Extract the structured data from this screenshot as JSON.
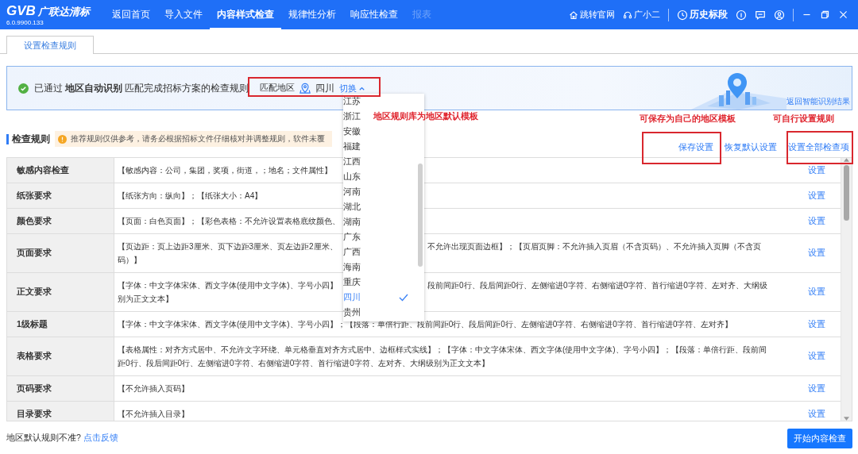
{
  "header": {
    "logo": "GVB",
    "brand": "广联达清标",
    "version": "6.0.9900.133",
    "nav": [
      {
        "label": "返回首页",
        "selected": false,
        "disabled": false
      },
      {
        "label": "导入文件",
        "selected": false,
        "disabled": false
      },
      {
        "label": "内容样式检查",
        "selected": true,
        "disabled": false
      },
      {
        "label": "规律性分析",
        "selected": false,
        "disabled": false
      },
      {
        "label": "响应性检查",
        "selected": false,
        "disabled": false
      },
      {
        "label": "报表",
        "selected": false,
        "disabled": true
      }
    ],
    "links": [
      "跳转官网",
      "广小二"
    ],
    "history": "历史标段"
  },
  "tabs": [
    {
      "label": "设置检查规则",
      "selected": true
    }
  ],
  "banner": {
    "prefix": "已通过",
    "highlight": "地区自动识别",
    "suffix": "匹配完成招标方案的检查规则",
    "region_label": "匹配地区",
    "region": "四川",
    "switch": "切换",
    "back_link": "返回智能识别结果"
  },
  "region_dropdown": [
    {
      "label": "江苏",
      "selected": false
    },
    {
      "label": "浙江",
      "selected": false
    },
    {
      "label": "安徽",
      "selected": false
    },
    {
      "label": "福建",
      "selected": false
    },
    {
      "label": "江西",
      "selected": false
    },
    {
      "label": "山东",
      "selected": false
    },
    {
      "label": "河南",
      "selected": false
    },
    {
      "label": "湖北",
      "selected": false
    },
    {
      "label": "湖南",
      "selected": false
    },
    {
      "label": "广东",
      "selected": false
    },
    {
      "label": "广西",
      "selected": false
    },
    {
      "label": "海南",
      "selected": false
    },
    {
      "label": "重庆",
      "selected": false
    },
    {
      "label": "四川",
      "selected": true
    },
    {
      "label": "贵州",
      "selected": false
    }
  ],
  "annotations": [
    "地区规则库为地区默认模板",
    "可保存为自己的地区模板",
    "可自行设置规则"
  ],
  "rules": {
    "title": "检查规则",
    "notice": "推荐规则仅供参考，请务必根据招标文件仔细核对并调整规则，软件未覆",
    "actions": [
      "保存设置",
      "恢复默认设置",
      "设置全部检查项"
    ],
    "rows": [
      {
        "label": "敏感内容检查",
        "lines": [
          {
            "left": "【敏感内容：公司，集团，奖项，街道，；地名；文件属性】"
          }
        ],
        "action": "设置"
      },
      {
        "label": "纸张要求",
        "lines": [
          {
            "left": "【纸张方向：纵向】；【纸张大小：A4】"
          }
        ],
        "action": "设置"
      },
      {
        "label": "颜色要求",
        "lines": [
          {
            "left": "【页面：白色页面】；【彩色表格：不允许设置表格底纹颜色、"
          }
        ],
        "action": "设置"
      },
      {
        "label": "页面要求",
        "lines": [
          {
            "left": "【页边距：页上边距3厘米、页下边距3厘米、页左边距2厘米、",
            "right": "不允许出现页面边框】；【页眉页脚：不允许插入页眉（不含页码）、不允许插入页脚（不含页"
          },
          {
            "left": "码）】"
          }
        ],
        "action": "设置"
      },
      {
        "label": "正文要求",
        "lines": [
          {
            "left": "【字体：中文字体宋体、西文字体(使用中文字体)、字号小四】",
            "right": "段前间距0行、段后间距0行、左侧缩进0字符、右侧缩进0字符、首行缩进0字符、左对齐、大纲级"
          },
          {
            "left": "别为正文文本】"
          }
        ],
        "action": "设置"
      },
      {
        "label": "1级标题",
        "text": "【字体：中文字体宋体、西文字体(使用中文字体)、字号小四】；【段落：单倍行距、段前间距0行、段后间距0行、左侧缩进0字符、右侧缩进0字符、首行缩进0字符、左对齐】",
        "action": "设置"
      },
      {
        "label": "表格要求",
        "text": "【表格属性：对齐方式居中、不允许文字环绕、单元格垂直对齐方式居中、边框样式实线】；【字体：中文字体宋体、西文字体(使用中文字体)、字号小四】；【段落：单倍行距、段前间距0行、段后间距0行、左侧缩进0字符、右侧缩进0字符、首行缩进0字符、左对齐、大纲级别为正文文本】",
        "action": "设置"
      },
      {
        "label": "页码要求",
        "text": "【不允许插入页码】",
        "action": "设置"
      },
      {
        "label": "目录要求",
        "text": "【不允许插入目录】",
        "action": "设置"
      }
    ]
  },
  "footer": {
    "question": "地区默认规则不准?",
    "link": "点击反馈",
    "button": "开始内容检查"
  }
}
